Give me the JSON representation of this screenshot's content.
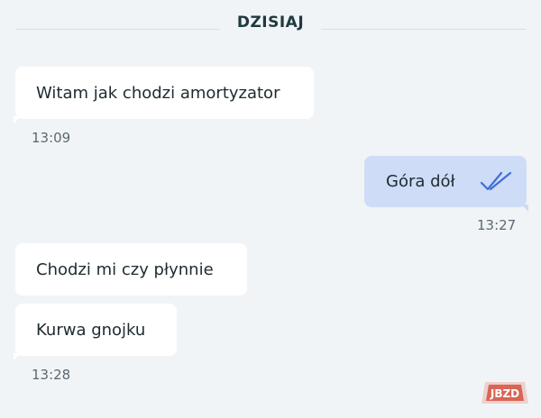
{
  "header": {
    "date_label": "DZISIAJ"
  },
  "messages": [
    {
      "direction": "in",
      "text": "Witam jak chodzi amortyzator",
      "time": "13:09"
    },
    {
      "direction": "out",
      "text": "Góra dół",
      "time": "13:27",
      "status_icon": "double-check-icon"
    },
    {
      "direction": "in",
      "text": "Chodzi mi czy płynnie"
    },
    {
      "direction": "in",
      "text": "Kurwa gnojku",
      "time": "13:28"
    }
  ],
  "watermark": {
    "text": "JBZD"
  },
  "colors": {
    "background": "#f1f4f7",
    "incoming_bubble": "#ffffff",
    "outgoing_bubble": "#cfdcf7",
    "read_check": "#3f6fd8",
    "watermark": "#d6523f"
  }
}
